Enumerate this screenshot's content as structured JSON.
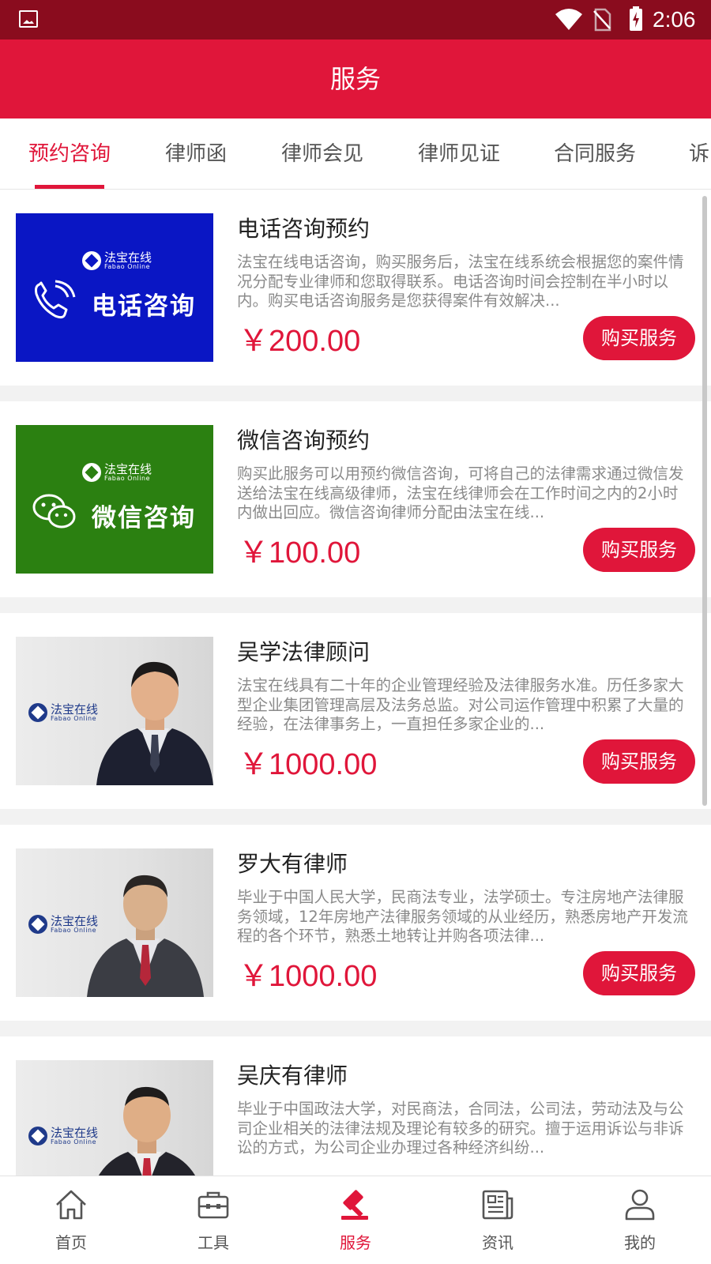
{
  "status_bar": {
    "time": "2:06",
    "icons": [
      "gallery-icon",
      "wifi-icon",
      "sim-card-off-icon",
      "battery-charging-icon"
    ]
  },
  "app_bar": {
    "title": "服务"
  },
  "tabs": [
    {
      "label": "预约咨询",
      "active": true
    },
    {
      "label": "律师函",
      "active": false
    },
    {
      "label": "律师会见",
      "active": false
    },
    {
      "label": "律师见证",
      "active": false
    },
    {
      "label": "合同服务",
      "active": false
    },
    {
      "label": "诉",
      "active": false
    }
  ],
  "brand": {
    "cn": "法宝在线",
    "en": "Fabao Online"
  },
  "services": [
    {
      "title": "电话咨询预约",
      "thumb_text": "电话咨询",
      "description": "法宝在线电话咨询，购买服务后，法宝在线系统会根据您的案件情况分配专业律师和您取得联系。电话咨询时间会控制在半小时以内。购买电话咨询服务是您获得案件有效解决...",
      "price": "￥200.00",
      "button": "购买服务"
    },
    {
      "title": "微信咨询预约",
      "thumb_text": "微信咨询",
      "description": "购买此服务可以用预约微信咨询，可将自己的法律需求通过微信发送给法宝在线高级律师，法宝在线律师会在工作时间之内的2小时内做出回应。微信咨询律师分配由法宝在线...",
      "price": "￥100.00",
      "button": "购买服务"
    },
    {
      "title": "吴学法律顾问",
      "description": "法宝在线具有二十年的企业管理经验及法律服务水准。历任多家大型企业集团管理高层及法务总监。对公司运作管理中积累了大量的经验，在法律事务上，一直担任多家企业的...",
      "price": "￥1000.00",
      "button": "购买服务"
    },
    {
      "title": "罗大有律师",
      "description": "毕业于中国人民大学，民商法专业，法学硕士。专注房地产法律服务领域，12年房地产法律服务领域的从业经历，熟悉房地产开发流程的各个环节，熟悉土地转让并购各项法律...",
      "price": "￥1000.00",
      "button": "购买服务"
    },
    {
      "title": "吴庆有律师",
      "description": "毕业于中国政法大学，对民商法，合同法，公司法，劳动法及与公司企业相关的法律法规及理论有较多的研究。擅于运用诉讼与非诉讼的方式，为公司企业办理过各种经济纠纷...",
      "price": "",
      "button": ""
    }
  ],
  "bottom_nav": [
    {
      "label": "首页",
      "icon": "home-icon",
      "active": false
    },
    {
      "label": "工具",
      "icon": "toolbox-icon",
      "active": false
    },
    {
      "label": "服务",
      "icon": "gavel-icon",
      "active": true
    },
    {
      "label": "资讯",
      "icon": "news-icon",
      "active": false
    },
    {
      "label": "我的",
      "icon": "user-icon",
      "active": false
    }
  ],
  "colors": {
    "status_bar": "#8a0c1e",
    "accent": "#e0163a",
    "phone_thumb": "#0a16c4",
    "wechat_thumb": "#2b8011"
  }
}
